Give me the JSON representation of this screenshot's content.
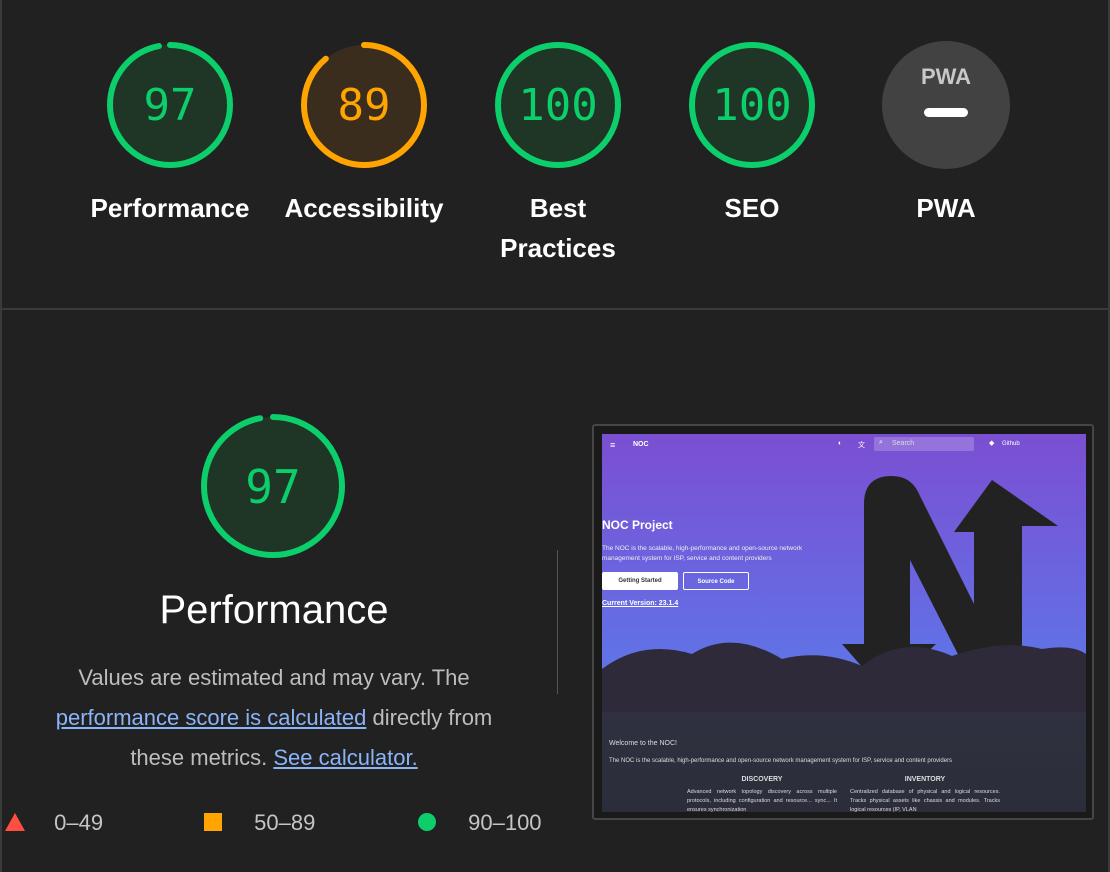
{
  "summary": {
    "gauges": [
      {
        "label_line1": "Performance",
        "label_line2": "",
        "score": "97",
        "color": "#0cce6b",
        "fraction": 0.97
      },
      {
        "label_line1": "Accessibility",
        "label_line2": "",
        "score": "89",
        "color": "#ffa400",
        "fraction": 0.89
      },
      {
        "label_line1": "Best",
        "label_line2": "Practices",
        "score": "100",
        "color": "#0cce6b",
        "fraction": 1.0
      },
      {
        "label_line1": "SEO",
        "label_line2": "",
        "score": "100",
        "color": "#0cce6b",
        "fraction": 1.0
      },
      {
        "label_line1": "PWA",
        "label_line2": "",
        "badge_text": "PWA",
        "score": "—"
      }
    ]
  },
  "performance": {
    "score": "97",
    "fraction": 0.97,
    "title": "Performance",
    "desc_part1": "Values are estimated and may vary. The",
    "desc_link1": "performance score is calculated",
    "desc_part2": "directly from",
    "desc_part3": "these metrics.",
    "desc_link2": "See calculator."
  },
  "legend": {
    "fail": "0–49",
    "average": "50–89",
    "pass": "90–100"
  },
  "thumbnail": {
    "nav_brand": "NOC",
    "search_placeholder": "Search",
    "nav_right": "Github",
    "hero_title": "NOC Project",
    "hero_text_line1": "The NOC is the scalable, high-performance and open-source network",
    "hero_text_line2": "management system for ISP, service and content providers",
    "btn_getting_started": "Getting Started",
    "btn_source_code": "Source Code",
    "version": "Current Version: 23.1.4",
    "welcome": "Welcome to the NOC!",
    "intro": "The NOC is the scalable, high-performance and open-source network management system for ISP, service and content providers",
    "col1_title": "DISCOVERY",
    "col1_text": "Advanced network topology discovery across multiple protocols, including configuration and resource... sync... It ensures synchronization",
    "col2_title": "INVENTORY",
    "col2_text": "Centralized database of physical and logical resources. Tracks physical assets like chassis and modules. Tracks logical resources (IP, VLAN"
  },
  "colors": {
    "pass": "#0cce6b",
    "average": "#ffa400",
    "fail": "#ff4e42",
    "link": "#8ab4f8"
  }
}
